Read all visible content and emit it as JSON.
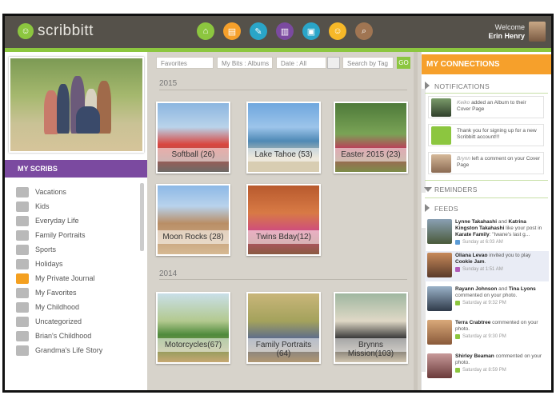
{
  "header": {
    "app_name": "scribbitt",
    "welcome_label": "Welcome",
    "user_name": "Erin Henry",
    "nav_icons": [
      {
        "icon": "home-icon",
        "color": "#8cc63f",
        "glyph": "⌂"
      },
      {
        "icon": "scrapbook-icon",
        "color": "#f6a02b",
        "glyph": "▤"
      },
      {
        "icon": "journal-icon",
        "color": "#2aa5c8",
        "glyph": "✎"
      },
      {
        "icon": "albums-icon",
        "color": "#7b4aa0",
        "glyph": "▥"
      },
      {
        "icon": "photos-icon",
        "color": "#2aa5c8",
        "glyph": "▣"
      },
      {
        "icon": "people-icon",
        "color": "#f6b828",
        "glyph": "☺"
      },
      {
        "icon": "search-icon",
        "color": "#a07552",
        "glyph": "⌕"
      }
    ],
    "accent": "#8cc63f"
  },
  "sidebar": {
    "title": "MY SCRIBS",
    "items": [
      {
        "label": "Vacations",
        "icon": "vacation-icon"
      },
      {
        "label": "Kids",
        "icon": "kids-icon"
      },
      {
        "label": "Everyday Life",
        "icon": "everyday-icon"
      },
      {
        "label": "Family Portraits",
        "icon": "portrait-icon"
      },
      {
        "label": "Sports",
        "icon": "sports-icon"
      },
      {
        "label": "Holidays",
        "icon": "holiday-tree-icon"
      },
      {
        "label": "My Private Journal",
        "icon": "lock-icon"
      },
      {
        "label": "My Favorites",
        "icon": "heart-icon"
      },
      {
        "label": "My Childhood",
        "icon": "gear-icon"
      },
      {
        "label": "Uncategorized",
        "icon": "cloud-icon"
      },
      {
        "label": "Brian's Childhood",
        "icon": "smile-icon"
      },
      {
        "label": "Grandma's Life Story",
        "icon": "book-icon"
      }
    ]
  },
  "filters": {
    "favorites": "Favorites",
    "my_bits": "My Bits :  Albums",
    "date": "Date :  All",
    "search_tag": "Search by Tag",
    "go": "GO"
  },
  "timeline": {
    "years": [
      {
        "year": "2015",
        "albums": [
          {
            "label": "Softball (26)",
            "bg": "linear-gradient(180deg,#8cb6e0 0%,#b9d3ea 35%,#d9463f 60%,#6d6b67 100%)"
          },
          {
            "label": "Lake Tahoe (53)",
            "bg": "linear-gradient(180deg,#6fa7de 0%,#9cc4ea 35%,#4f89b5 55%,#d8cdb2 80%)"
          },
          {
            "label": "Easter 2015 (23)",
            "bg": "linear-gradient(180deg,#4e7a3a 0%,#7aa356 45%,#b8445a 65%,#7d8d4a 100%)"
          }
        ]
      },
      {
        "year": "",
        "albums": [
          {
            "label": "Moon Rocks (28)",
            "bg": "linear-gradient(180deg,#8db8e6 0%,#b8d2ec 30%,#b98e66 55%,#d6b993 100%)"
          },
          {
            "label": "Twins Bday(12)",
            "bg": "linear-gradient(180deg,#b85a2e 0%,#d87a45 40%,#cf4f7b 65%,#8a5a42 100%)"
          }
        ]
      },
      {
        "year": "2014",
        "albums": [
          {
            "label": "Motorcycles(67)",
            "bg": "linear-gradient(180deg,#c9dfe8 0%,#b3c98f 40%,#4f8a3c 60%,#c7a873 100%)"
          },
          {
            "label": "Family Portraits (64)",
            "bg": "linear-gradient(180deg,#c9b67a 0%,#a4a25c 40%,#5f6e8a 65%,#b29873 100%)"
          },
          {
            "label": "Brynns Mission(103)",
            "bg": "linear-gradient(180deg,#9fb7a0 0%,#dfd8c6 40%,#3a3a3a 65%,#cfc4b0 100%)"
          }
        ]
      }
    ]
  },
  "connections": {
    "title": "MY CONNECTIONS",
    "notifications_label": "NOTIFICATIONS",
    "notifications": [
      {
        "who": "Keiko",
        "text": " added an Album to their Cover Page",
        "photo": "linear-gradient(#7a9b6a,#2f3f2a)"
      },
      {
        "who": "",
        "text": "Thank you for signing up for a new Scribbitt account!!!",
        "photo": "#8cc63f"
      },
      {
        "who": "Brynn",
        "text": " left a comment on your Cover Page",
        "photo": "linear-gradient(#d6b99a,#8a6a52)"
      }
    ],
    "reminders_label": "REMINDERS",
    "feed_label": "FEEDS",
    "feed": [
      {
        "title": "Lynne Takahashi",
        "mid": " and ",
        "title2": "Katrina Kingston Takahashi",
        "text": " like your post in ",
        "target": "Karate Family",
        "text2": ": \"Iwane's last g...",
        "time": "Sunday at 6:03 AM",
        "photo": "linear-gradient(#8aa0b4,#4a5a3a)",
        "tag": "#5b9bd5"
      },
      {
        "title": "Oliana Levao",
        "mid": "",
        "title2": "",
        "text": " invited you to play ",
        "target": "Cookie Jam",
        "text2": ".",
        "time": "Sunday at 1:51 AM",
        "photo": "linear-gradient(#c78a5a,#5a3a2a)",
        "tag": "#b05ab8"
      },
      {
        "title": "Rayann Johnson",
        "mid": " and ",
        "title2": "Tina Lyons",
        "text": " commented on your photo.",
        "target": "",
        "text2": "",
        "time": "Saturday at 9:32 PM",
        "photo": "linear-gradient(#9ab2c8,#2f3a4a)",
        "tag": "#8cc63f"
      },
      {
        "title": "Terra Crabtree",
        "mid": "",
        "title2": "",
        "text": " commented on your photo.",
        "target": "",
        "text2": "",
        "time": "Saturday at 9:30 PM",
        "photo": "linear-gradient(#d9a97a,#8a5a3a)",
        "tag": "#8cc63f"
      },
      {
        "title": "Shirley Beaman",
        "mid": "",
        "title2": "",
        "text": " commented on your photo.",
        "target": "",
        "text2": "",
        "time": "Saturday at 8:59 PM",
        "photo": "linear-gradient(#c89a9a,#6a3a3a)",
        "tag": "#8cc63f"
      }
    ]
  }
}
